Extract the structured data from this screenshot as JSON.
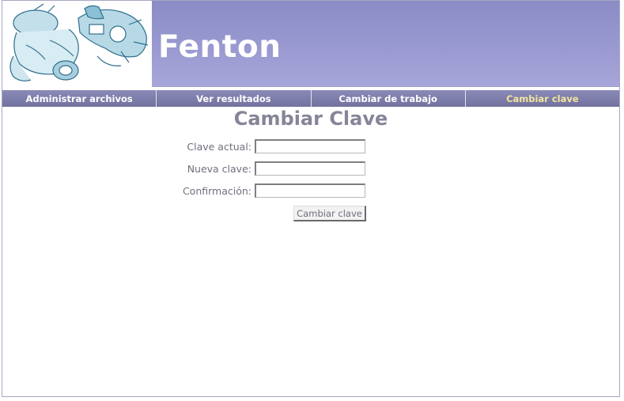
{
  "header": {
    "site_title": "Fenton",
    "logo_icon": "astronaut-robot-drawing-icon"
  },
  "nav": {
    "items": [
      {
        "label": "Administrar archivos"
      },
      {
        "label": "Ver resultados"
      },
      {
        "label": "Cambiar de trabajo"
      },
      {
        "label": "Cambiar clave",
        "active": true
      }
    ]
  },
  "page": {
    "title": "Cambiar Clave"
  },
  "form": {
    "current_label": "Clave actual:",
    "current_value": "",
    "new_label": "Nueva clave:",
    "new_value": "",
    "confirm_label": "Confirmación:",
    "confirm_value": "",
    "submit_label": "Cambiar clave"
  },
  "colors": {
    "banner": "#9a9ad0",
    "nav": "#7f7fb3",
    "active_nav_text": "#f3e59b",
    "title_text": "#858598"
  }
}
